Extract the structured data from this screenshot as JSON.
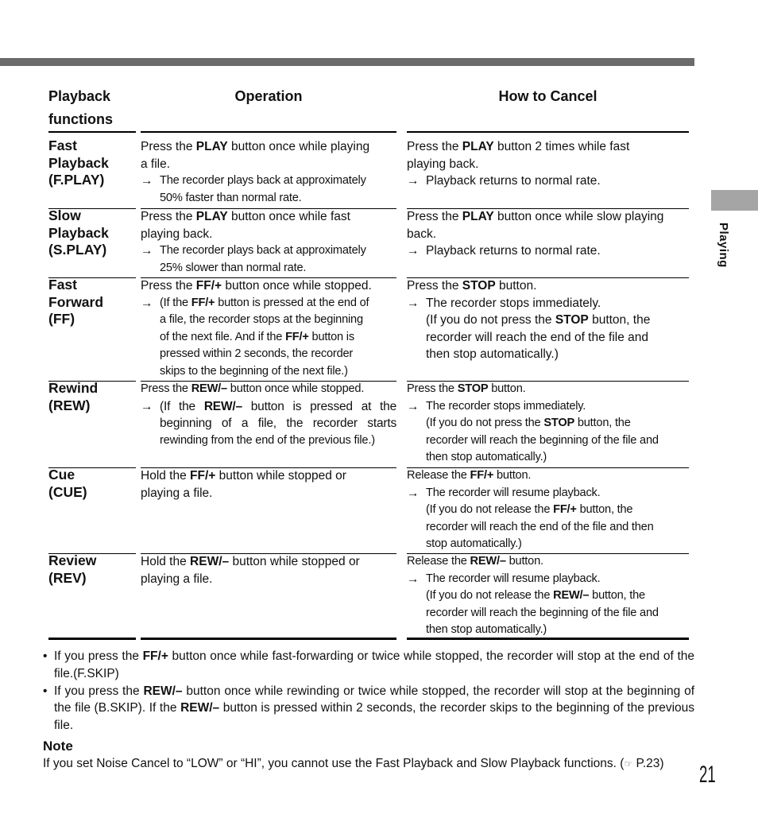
{
  "side_tab": {
    "label": "Playing"
  },
  "headers": {
    "functions_line1": "Playback",
    "functions_line2": "functions",
    "operation": "Operation",
    "cancel": "How to Cancel"
  },
  "rows": [
    {
      "name": [
        "Fast",
        "Playback",
        "(F.PLAY)"
      ],
      "operation": {
        "lines": [
          [
            "Press the ",
            "PLAY",
            " button once while playing"
          ],
          [
            "a file."
          ]
        ],
        "result": [
          "The recorder plays back at approximately",
          "50% faster than normal rate."
        ]
      },
      "cancel": {
        "lines": [
          [
            "Press the ",
            "PLAY",
            " button 2 times while fast"
          ],
          [
            "playing back."
          ]
        ],
        "result": [
          "Playback returns to normal rate."
        ]
      }
    },
    {
      "name": [
        "Slow",
        "Playback",
        "(S.PLAY)"
      ],
      "operation": {
        "lines": [
          [
            "Press the ",
            "PLAY",
            " button once while fast"
          ],
          [
            "playing back."
          ]
        ],
        "result": [
          "The recorder plays back at approximately",
          "25% slower than normal rate."
        ]
      },
      "cancel": {
        "lines": [
          [
            "Press the ",
            "PLAY",
            " button once while slow playing"
          ],
          [
            "back."
          ]
        ],
        "result": [
          "Playback returns to normal rate."
        ]
      }
    },
    {
      "name": [
        "Fast",
        "Forward",
        "(FF)"
      ],
      "operation": {
        "lines": [
          [
            "Press the ",
            "FF/+",
            " button once while stopped."
          ]
        ],
        "result": [
          [
            "(If the ",
            "FF/+",
            " button is pressed at the end of"
          ],
          [
            "a file, the recorder stops at the beginning"
          ],
          [
            "of the next file.  And if the ",
            "FF/+",
            " button is"
          ],
          [
            "pressed within 2 seconds, the recorder"
          ],
          [
            "skips to the beginning of the next file.)"
          ]
        ]
      },
      "cancel": {
        "lines": [
          [
            "Press the ",
            "STOP",
            " button."
          ]
        ],
        "result": [
          [
            "The recorder stops immediately."
          ],
          [
            " (If you do not press the ",
            "STOP",
            " button, the"
          ],
          [
            "recorder will reach the end of the file and"
          ],
          [
            "then stop automatically.)"
          ]
        ]
      }
    },
    {
      "name": [
        "Rewind",
        "(REW)"
      ],
      "operation": {
        "lines": [
          [
            "Press the ",
            "REW/–",
            " button once while stopped."
          ]
        ],
        "result": [
          [
            "(If the ",
            "REW/–",
            " button is pressed at the"
          ],
          [
            "beginning of a file, the recorder starts"
          ],
          [
            "rewinding from the end of the previous file.)"
          ]
        ]
      },
      "cancel": {
        "lines": [
          [
            "Press the ",
            "STOP",
            " button."
          ]
        ],
        "result": [
          [
            "The recorder stops immediately."
          ],
          [
            " (If you do not press the ",
            "STOP",
            " button, the"
          ],
          [
            "recorder will reach the beginning of the file and"
          ],
          [
            "then stop automatically.)"
          ]
        ]
      }
    },
    {
      "name": [
        "Cue",
        "(CUE)"
      ],
      "operation": {
        "lines": [
          [
            "Hold the ",
            "FF/+",
            " button while stopped or"
          ],
          [
            "playing a file."
          ]
        ],
        "result": []
      },
      "cancel": {
        "lines": [
          [
            "Release the ",
            "FF/+",
            " button."
          ]
        ],
        "result": [
          [
            "The recorder will resume playback."
          ],
          [
            "(If you do not release the ",
            "FF/+",
            " button, the"
          ],
          [
            "recorder will reach the end of the file and then"
          ],
          [
            "stop automatically.)"
          ]
        ]
      }
    },
    {
      "name": [
        "Review",
        "(REV)"
      ],
      "operation": {
        "lines": [
          [
            "Hold the ",
            "REW/–",
            " button while stopped or"
          ],
          [
            "playing a file."
          ]
        ],
        "result": []
      },
      "cancel": {
        "lines": [
          [
            "Release the ",
            "REW/–",
            " button."
          ]
        ],
        "result": [
          [
            "The recorder will resume playback."
          ],
          [
            "(If you do not release the ",
            "REW/–",
            " button, the"
          ],
          [
            "recorder will reach the beginning of the file and"
          ],
          [
            "then stop automatically.)"
          ]
        ]
      }
    }
  ],
  "bullets": [
    [
      "If you press the ",
      "FF/+",
      " button once while fast-forwarding or twice while stopped, the recorder will stop at the end of the file.(F.SKIP)"
    ],
    [
      "If you press the ",
      "REW/–",
      " button once while rewinding or twice while stopped, the recorder will stop at the beginning of the file (B.SKIP). If the ",
      "REW/–",
      " button is pressed within 2 seconds, the recorder skips to the beginning of the previous file."
    ]
  ],
  "bullet_symbol": "•",
  "arrow_symbol": "→",
  "note": {
    "title": "Note",
    "body": "If you set Noise Cancel to “LOW” or “HI”, you cannot use the Fast Playback and Slow Playback functions.",
    "ref_icon": "☞",
    "ref_text": " P.23)",
    "ref_open": "("
  },
  "page_number": "21"
}
